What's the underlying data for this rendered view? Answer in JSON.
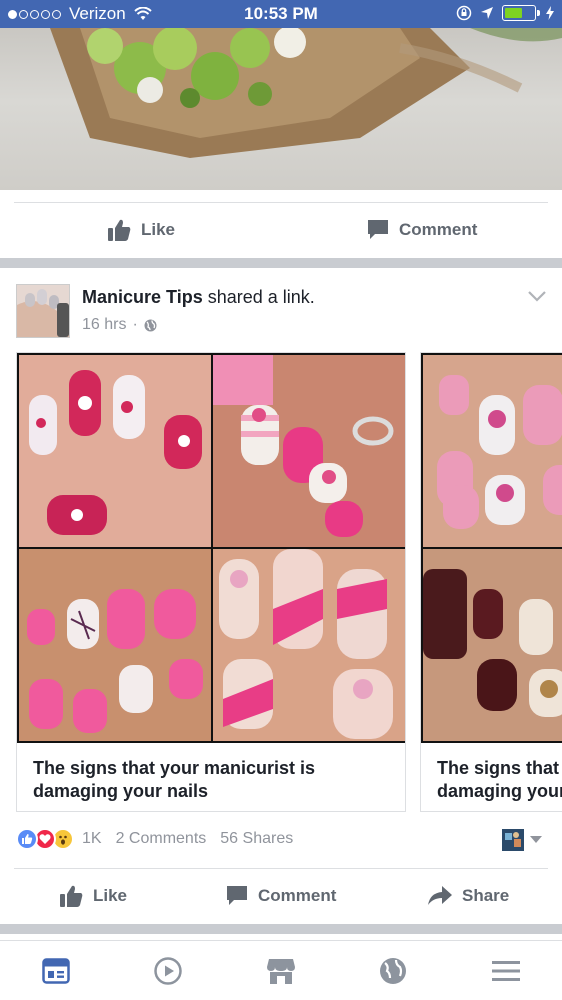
{
  "status_bar": {
    "carrier": "Verizon",
    "time": "10:53 PM"
  },
  "top_post": {
    "like_label": "Like",
    "comment_label": "Comment"
  },
  "post": {
    "page_name": "Manicure Tips",
    "action_text": "shared a link.",
    "time": "16 hrs",
    "separator": "·",
    "cards": [
      {
        "caption": "The signs that your manicurist is damaging your nails"
      },
      {
        "caption": "The signs that your manicurist is damaging your nails"
      }
    ],
    "reaction_count": "1K",
    "comments_text": "2 Comments",
    "shares_text": "56 Shares",
    "like_label": "Like",
    "comment_label": "Comment",
    "share_label": "Share"
  },
  "colors": {
    "brand": "#4267b2",
    "like_blue": "#598bf6",
    "love_red": "#f0284a",
    "wow_yellow": "#f7c63a",
    "meta_gray": "#90949c",
    "action_gray": "#606770"
  },
  "icons": {
    "tab_bar": [
      "news-feed-icon",
      "video-icon",
      "marketplace-icon",
      "globe-icon",
      "menu-icon"
    ]
  }
}
